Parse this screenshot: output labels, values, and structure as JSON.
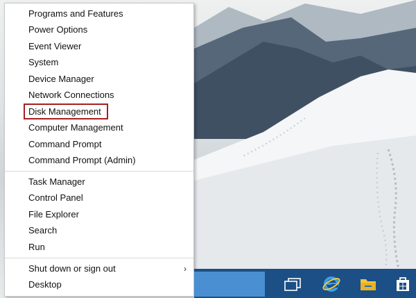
{
  "menu": {
    "items_group1": [
      {
        "label": "Programs and Features"
      },
      {
        "label": "Power Options"
      },
      {
        "label": "Event Viewer"
      },
      {
        "label": "System"
      },
      {
        "label": "Device Manager"
      },
      {
        "label": "Network Connections"
      },
      {
        "label": "Disk Management",
        "highlighted": true
      },
      {
        "label": "Computer Management"
      },
      {
        "label": "Command Prompt"
      },
      {
        "label": "Command Prompt (Admin)"
      }
    ],
    "items_group2": [
      {
        "label": "Task Manager"
      },
      {
        "label": "Control Panel"
      },
      {
        "label": "File Explorer"
      },
      {
        "label": "Search"
      },
      {
        "label": "Run"
      }
    ],
    "items_group3": [
      {
        "label": "Shut down or sign out",
        "submenu_arrow": "›"
      },
      {
        "label": "Desktop"
      }
    ]
  },
  "taskbar": {
    "icons": [
      "task-view-icon",
      "internet-explorer-icon",
      "file-explorer-icon",
      "store-icon"
    ],
    "accent": "#1c4f85",
    "search_color": "#4a8fd1"
  },
  "colors": {
    "highlight_outline": "#a3201f"
  }
}
